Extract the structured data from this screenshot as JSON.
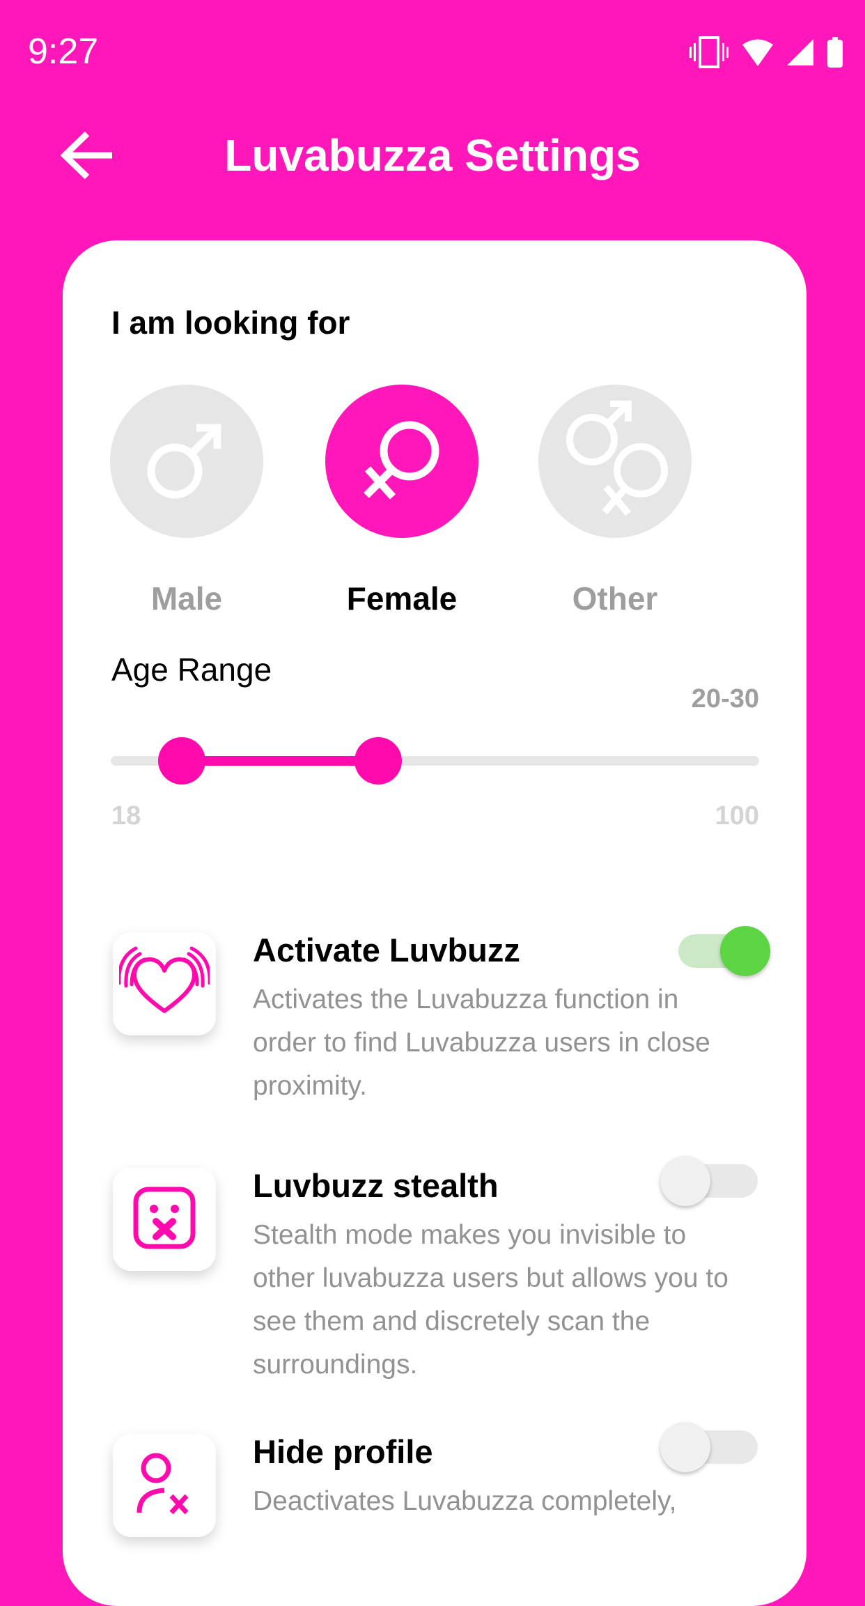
{
  "status_bar": {
    "time": "9:27",
    "icons": [
      "vibrate-icon",
      "wifi-icon",
      "cellular-signal-icon",
      "battery-icon"
    ]
  },
  "header": {
    "back_icon": "arrow-left-icon",
    "title": "Luvabuzza Settings"
  },
  "colors": {
    "brand": "#ff17b9",
    "accent": "#ff0aad",
    "toggle_on": "#5dd443",
    "inactive": "#e6e6e6"
  },
  "looking_for": {
    "label": "I am looking for",
    "options": [
      {
        "label": "Male",
        "icon": "male-symbol-icon",
        "selected": false
      },
      {
        "label": "Female",
        "icon": "female-symbol-icon",
        "selected": true
      },
      {
        "label": "Other",
        "icon": "male-female-symbol-icon",
        "selected": false
      }
    ]
  },
  "age_range": {
    "label": "Age Range",
    "value_text": "20-30",
    "min": 18,
    "max": 100,
    "min_label": "18",
    "max_label": "100",
    "low": 20,
    "high": 30
  },
  "settings": [
    {
      "title": "Activate Luvbuzz",
      "description": "Activates the Luvabuzza function in order to find Luvabuzza users in close proximity.",
      "icon": "heart-vibrate-icon",
      "enabled": true
    },
    {
      "title": "Luvbuzz stealth",
      "description": "Stealth mode makes you invisible to other luvabuzza users but allows you to see them and discretely scan the surroundings.",
      "icon": "silent-face-icon",
      "enabled": false
    },
    {
      "title": "Hide profile",
      "description": "Deactivates Luvabuzza completely,",
      "icon": "user-remove-icon",
      "enabled": false
    }
  ]
}
